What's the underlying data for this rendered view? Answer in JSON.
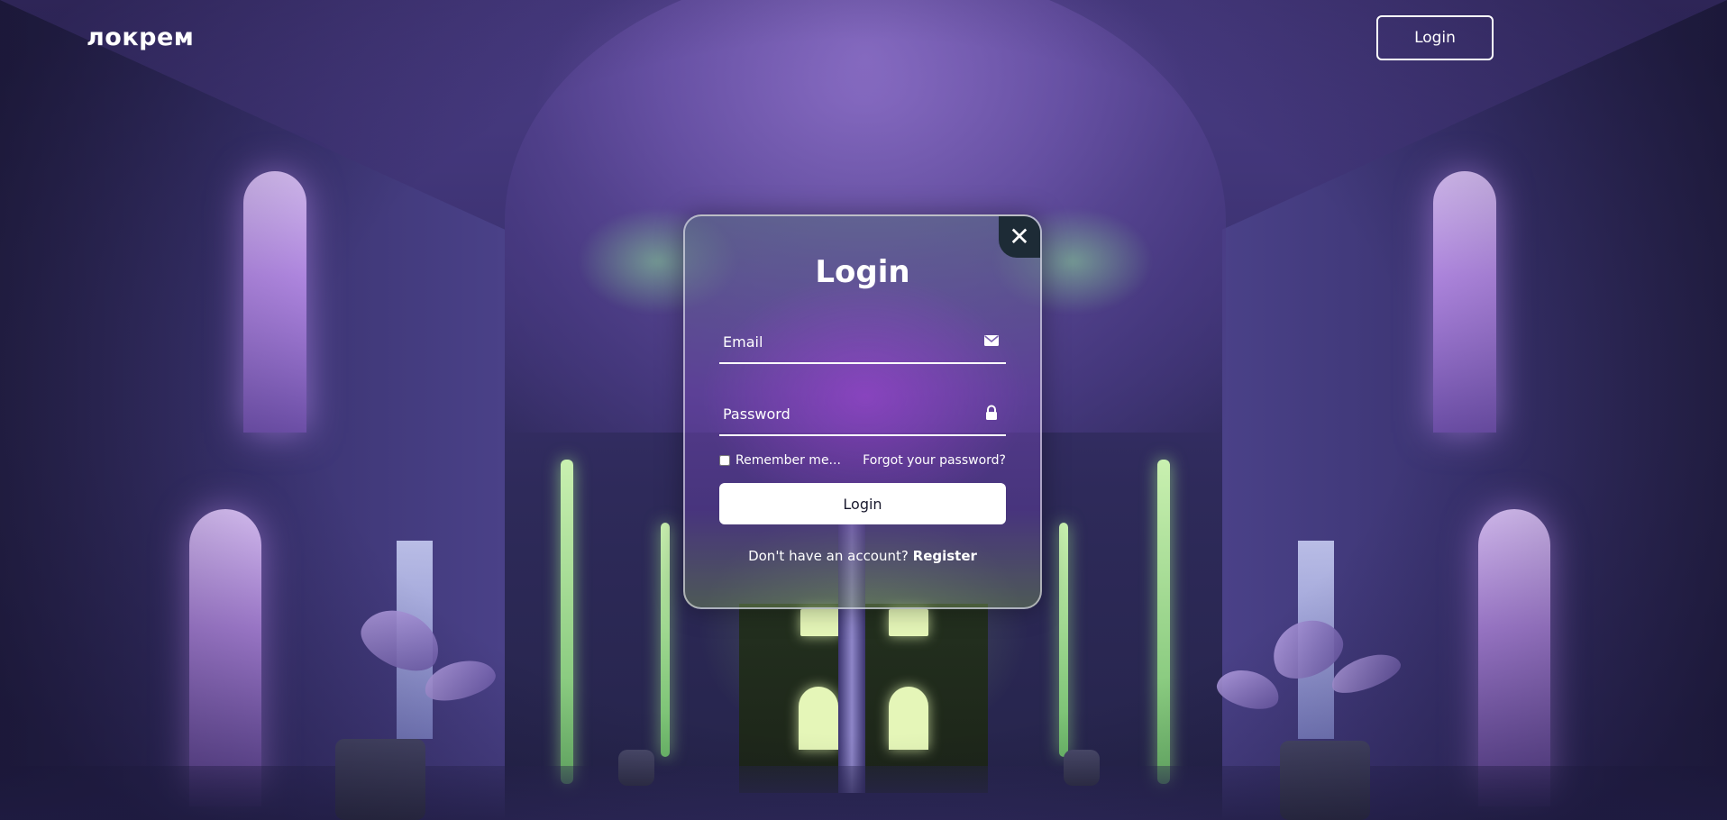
{
  "header": {
    "logo_text": "локрем",
    "login_label": "Login"
  },
  "modal": {
    "close_icon": "close-icon",
    "title": "Login",
    "email": {
      "placeholder": "Email",
      "icon": "mail-icon"
    },
    "password": {
      "placeholder": "Password",
      "icon": "lock-icon"
    },
    "remember_label": "Remember me...",
    "forgot_label": "Forgot your password?",
    "submit_label": "Login",
    "register_prompt": "Don't have an account?",
    "register_label": "Register"
  },
  "colors": {
    "text": "#ffffff",
    "button_bg": "#ffffff",
    "button_text": "#1a1a2e",
    "close_bg": "#1d2b36"
  }
}
